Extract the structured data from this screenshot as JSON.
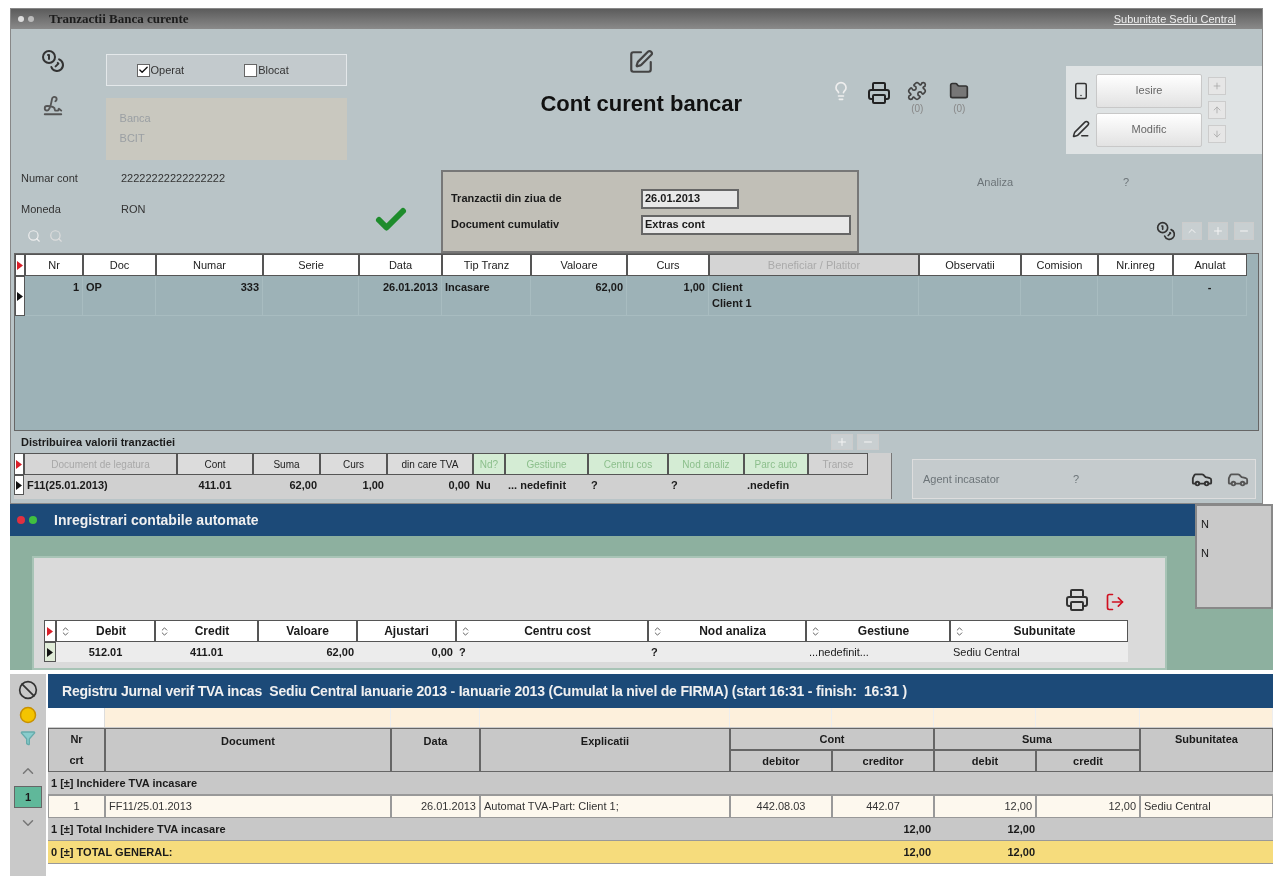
{
  "window": {
    "title": "Tranzactii Banca curente",
    "subunit_link": "Subunitate Sediu Central"
  },
  "status_checks": [
    {
      "label": "Operat",
      "checked": true
    },
    {
      "label": "Blocat",
      "checked": false
    }
  ],
  "bank": {
    "label": "Banca",
    "value": "BCIT"
  },
  "form_title": "Cont curent bancar",
  "toolbar_counts": [
    "(0)",
    "(0)"
  ],
  "buttons": [
    "Iesire",
    "Modific"
  ],
  "fields": [
    {
      "label": "Numar cont",
      "value": "22222222222222222"
    },
    {
      "label": "Moneda",
      "value": "RON"
    }
  ],
  "day_filter": [
    {
      "label": "Tranzactii din ziua de",
      "value": "26.01.2013"
    },
    {
      "label": "Document cumulativ",
      "value": "Extras cont"
    }
  ],
  "analysis": {
    "label": "Analiza",
    "value": "?"
  },
  "transactions": {
    "columns": [
      {
        "label": "Nr",
        "disabled": false
      },
      {
        "label": "Doc",
        "disabled": false
      },
      {
        "label": "Numar",
        "disabled": false
      },
      {
        "label": "Serie",
        "disabled": false
      },
      {
        "label": "Data",
        "disabled": false
      },
      {
        "label": "Tip Tranz",
        "disabled": false
      },
      {
        "label": "Valoare",
        "disabled": false
      },
      {
        "label": "Curs",
        "disabled": false
      },
      {
        "label": "Beneficiar / Platitor",
        "disabled": true
      },
      {
        "label": "Observatii",
        "disabled": false
      },
      {
        "label": "Comision",
        "disabled": false
      },
      {
        "label": "Nr.inreg",
        "disabled": false
      },
      {
        "label": "Anulat",
        "disabled": false
      }
    ],
    "rows": [
      {
        "selected": true,
        "cells": [
          "1",
          "OP",
          "333",
          "",
          "26.01.2013",
          "Incasare",
          "62,00",
          "1,00",
          "Client\nClient 1",
          "",
          "",
          "",
          "-"
        ]
      }
    ]
  },
  "distribution": {
    "title": "Distribuirea valorii tranzactiei",
    "columns": [
      {
        "label": "Document de legatura",
        "kind": "muted"
      },
      {
        "label": "Cont",
        "kind": "plain"
      },
      {
        "label": "Suma",
        "kind": "plain"
      },
      {
        "label": "Curs",
        "kind": "plain"
      },
      {
        "label": "din care TVA",
        "kind": "plain"
      },
      {
        "label": "Nd?",
        "kind": "green"
      },
      {
        "label": "Gestiune",
        "kind": "green"
      },
      {
        "label": "Centru cos",
        "kind": "green"
      },
      {
        "label": "Nod analiz",
        "kind": "green"
      },
      {
        "label": "Parc auto",
        "kind": "green"
      },
      {
        "label": "Transe",
        "kind": "muted"
      }
    ],
    "rows": [
      {
        "selected": true,
        "cells": [
          "F11(25.01.2013)",
          "411.01",
          "62,00",
          "1,00",
          "0,00",
          "Nu",
          "... nedefinit",
          "?",
          "?",
          ".nedefin",
          ""
        ]
      }
    ]
  },
  "agent": {
    "label": "Agent incasator",
    "value": "?"
  },
  "side_panel": [
    "N",
    "N"
  ],
  "entries_window": {
    "title": "Inregistrari contabile automate",
    "columns": [
      {
        "label": "Debit",
        "sortable": true
      },
      {
        "label": "Credit",
        "sortable": true
      },
      {
        "label": "Valoare",
        "sortable": false
      },
      {
        "label": "Ajustari",
        "sortable": false
      },
      {
        "label": "Centru cost",
        "sortable": true
      },
      {
        "label": "Nod analiza",
        "sortable": true
      },
      {
        "label": "Gestiune",
        "sortable": true
      },
      {
        "label": "Subunitate",
        "sortable": true
      }
    ],
    "rows": [
      {
        "selected": true,
        "cells": [
          "512.01",
          "411.01",
          "62,00",
          "0,00",
          "?",
          "?",
          "...nedefinit...",
          "Sediu Central"
        ]
      }
    ]
  },
  "journal": {
    "title": "Registru Jurnal verif TVA incas  Sediu Central Ianuarie 2013 - Ianuarie 2013 (Cumulat la nivel de FIRMA) (start 16:31 - finish:  16:31 )",
    "page": "1",
    "columns": [
      {
        "label": "Nr",
        "sub": "crt"
      },
      {
        "label": "Document"
      },
      {
        "label": "Data"
      },
      {
        "label": "Explicatii"
      },
      {
        "label": "Cont",
        "children": [
          "debitor",
          "creditor"
        ]
      },
      {
        "label": "Suma",
        "children": [
          "debit",
          "credit"
        ]
      },
      {
        "label": "Subunitatea"
      }
    ],
    "rows": [
      {
        "kind": "group",
        "label": "1 [±] Inchidere TVA incasare"
      },
      {
        "kind": "data",
        "cells": [
          "1",
          "FF11/25.01.2013",
          "26.01.2013",
          "Automat TVA-Part: Client 1;",
          "442.08.03",
          "442.07",
          "12,00",
          "12,00",
          "Sediu Central"
        ]
      },
      {
        "kind": "total",
        "label": "1 [±] Total Inchidere TVA incasare",
        "debit": "12,00",
        "credit": "12,00"
      },
      {
        "kind": "grand_total",
        "label": "0 [±] TOTAL GENERAL:",
        "debit": "12,00",
        "credit": "12,00"
      }
    ]
  }
}
